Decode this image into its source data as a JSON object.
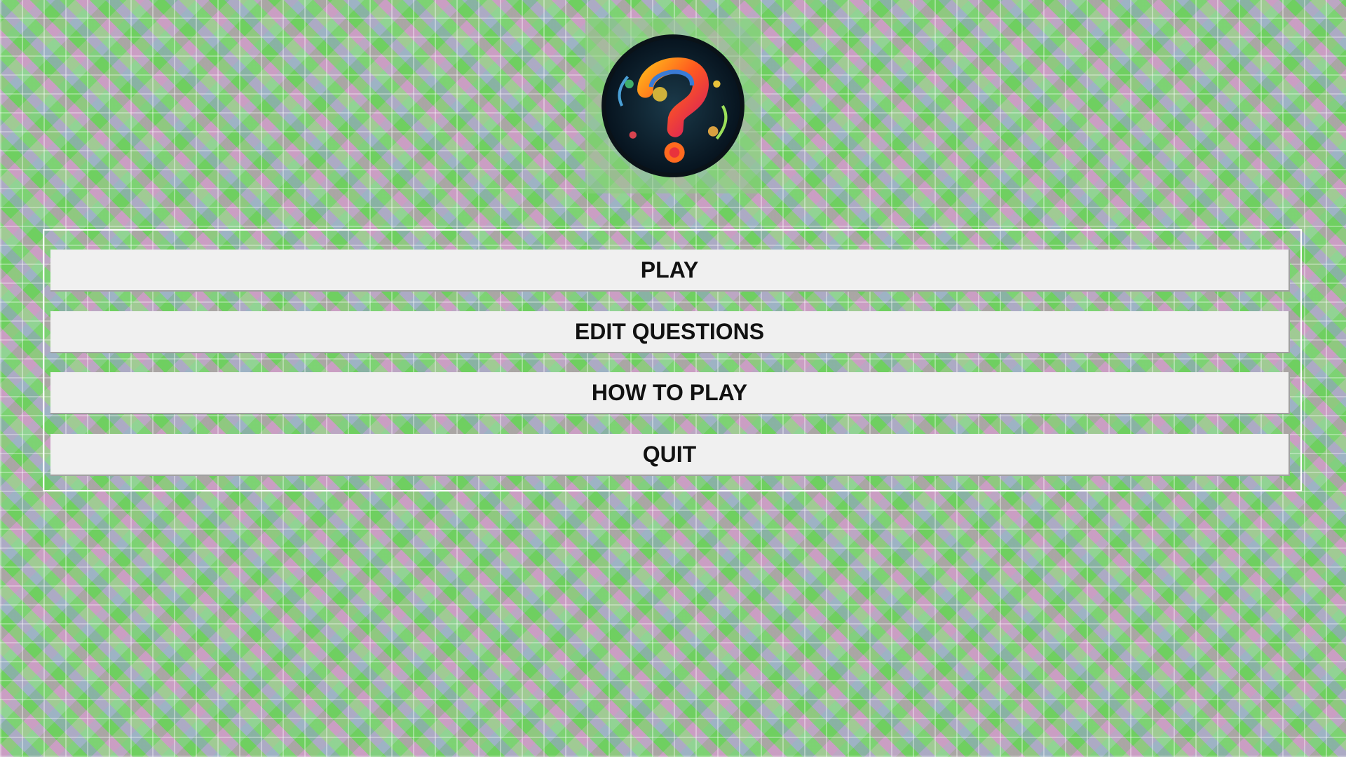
{
  "logo": {
    "icon": "question-mark-logo-icon",
    "colors": {
      "ring": "#1c2a3a",
      "inner": "#0f2030",
      "question_top": "#ff7a1a",
      "question_mid": "#e8323c",
      "question_swirl": "#3a7bd5"
    }
  },
  "menu": {
    "buttons": [
      {
        "label": "PLAY"
      },
      {
        "label": "EDIT QUESTIONS"
      },
      {
        "label": "HOW TO PLAY"
      },
      {
        "label": "QUIT"
      }
    ]
  },
  "colors": {
    "button_bg": "#f0f0f0",
    "button_text": "#111111",
    "panel_border": "#ffffff"
  }
}
